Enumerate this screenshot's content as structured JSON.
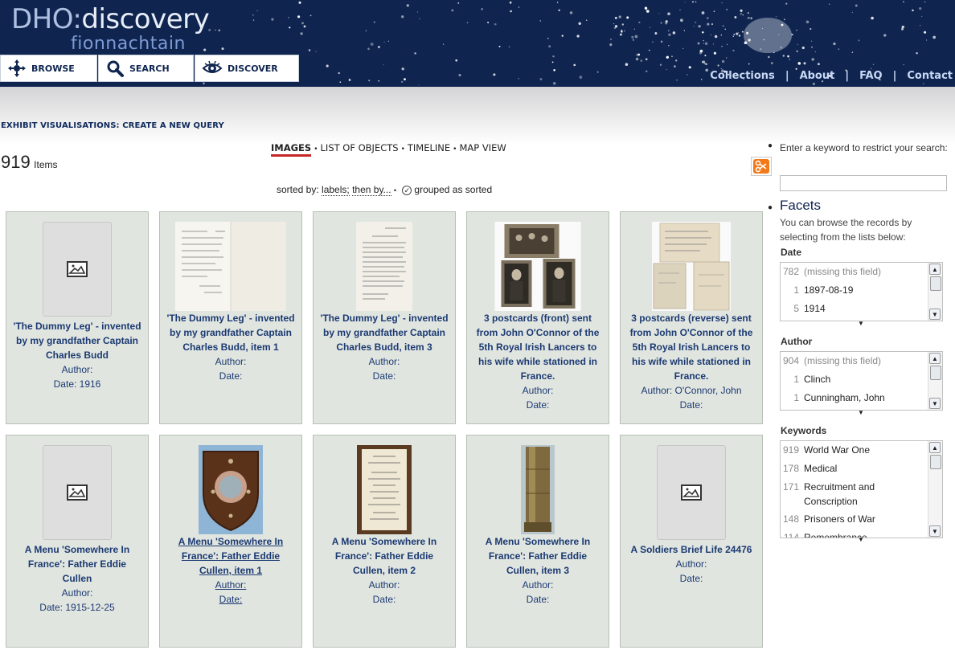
{
  "header": {
    "logo_prefix": "DHO:",
    "logo_main": "discovery",
    "logo_sub": "fionnachtain",
    "nav": [
      {
        "label": "BROWSE",
        "icon": "browse-arrows-icon"
      },
      {
        "label": "SEARCH",
        "icon": "magnifier-icon"
      },
      {
        "label": "DISCOVER",
        "icon": "eye-icon"
      }
    ],
    "links": [
      "Collections",
      "About",
      "FAQ",
      "Contact"
    ]
  },
  "query_title": "EXHIBIT VISUALISATIONS: CREATE A NEW QUERY",
  "count": {
    "number": "919",
    "label": "Items"
  },
  "views": {
    "images": "IMAGES",
    "list": "LIST OF OBJECTS",
    "timeline": "TIMELINE",
    "map": "MAP VIEW"
  },
  "sort": {
    "prefix": "sorted by:",
    "labels": "labels;",
    "then_by": "then by...",
    "grouped": "grouped as sorted"
  },
  "items": [
    {
      "title": "'The Dummy Leg' - invented by my grandfather Captain Charles Budd",
      "author": "Author:",
      "date": "Date: 1916"
    },
    {
      "title": "'The Dummy Leg' - invented by my grandfather Captain Charles Budd, item 1",
      "author": "Author:",
      "date": "Date:"
    },
    {
      "title": "'The Dummy Leg' - invented by my grandfather Captain Charles Budd, item 3",
      "author": "Author:",
      "date": "Date:"
    },
    {
      "title": "3 postcards (front) sent from John O'Connor of the 5th Royal Irish Lancers to his wife while stationed in France.",
      "author": "Author:",
      "date": "Date:"
    },
    {
      "title": "3 postcards (reverse) sent from John O'Connor of the 5th Royal Irish Lancers to his wife while stationed in France.",
      "author": "Author: O'Connor, John",
      "date": "Date:"
    },
    {
      "title": "A Menu 'Somewhere In France': Father Eddie Cullen",
      "author": "Author:",
      "date": "Date: 1915-12-25"
    },
    {
      "title": "A Menu 'Somewhere In France': Father Eddie Cullen, item 1",
      "author": "Author:",
      "date": "Date:"
    },
    {
      "title": "A Menu 'Somewhere In France': Father Eddie Cullen, item 2",
      "author": "Author:",
      "date": "Date:"
    },
    {
      "title": "A Menu 'Somewhere In France': Father Eddie Cullen, item 3",
      "author": "Author:",
      "date": "Date:"
    },
    {
      "title": "A Soldiers Brief Life 24476",
      "author": "Author:",
      "date": "Date:"
    }
  ],
  "sidebar": {
    "keyword_label": "Enter a keyword to restrict your search:",
    "facets_title": "Facets",
    "facets_desc": "You can browse the records by selecting from the lists below:",
    "facets": [
      {
        "title": "Date",
        "rows": [
          {
            "count": "782",
            "label": "(missing this field)"
          },
          {
            "count": "1",
            "label": "1897-08-19"
          },
          {
            "count": "5",
            "label": "1914"
          }
        ]
      },
      {
        "title": "Author",
        "rows": [
          {
            "count": "904",
            "label": "(missing this field)"
          },
          {
            "count": "1",
            "label": "Clinch"
          },
          {
            "count": "1",
            "label": "Cunningham, John"
          }
        ]
      },
      {
        "title": "Keywords",
        "rows": [
          {
            "count": "919",
            "label": "World War One"
          },
          {
            "count": "178",
            "label": "Medical"
          },
          {
            "count": "171",
            "label": "Recruitment and Conscription"
          },
          {
            "count": "148",
            "label": "Prisoners of War"
          },
          {
            "count": "114",
            "label": "Remembrance"
          }
        ]
      }
    ]
  },
  "colors": {
    "header_bg": "#0f2550",
    "link": "#1b3a72",
    "card_bg": "#e1e5e0",
    "active_underline": "#c62626"
  }
}
